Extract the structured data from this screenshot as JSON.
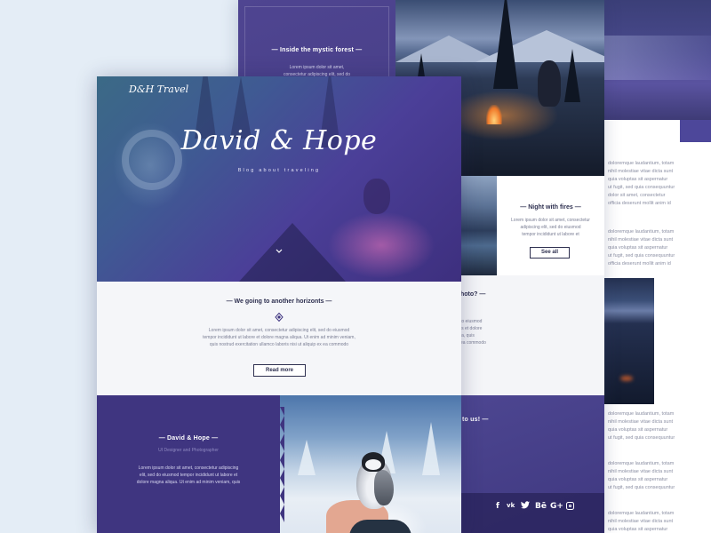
{
  "lorem": {
    "l1": "Lorem ipsum dolor sit amet,",
    "l2": "consectetur adipiscing elit, sed do",
    "l3": "Lorem ipsum dolor sit amet, consectetur",
    "l4": "adipiscing elit, sed do eiusmod",
    "l5": "tempor incididunt ut labore et",
    "l6": "Lorem ipsum dolor sit amet, consectetur adipiscing elit, sed do eiusmod",
    "l7": "tempor incididunt ut labore et dolore magna aliqua. Ut enim ad minim veniam,",
    "l8": "quis nostrud exercitation ullamco laboris nisi ut aliquip ex ea commodo",
    "l9": "Lorem ipsum dolor sit amet, consectetur adipiscing",
    "l10": "elit, sed do eiusmod tempor incididunt ut labore et",
    "l11": "dolore magna aliqua. Ut enim ad minim veniam, quis"
  },
  "back_page": {
    "forest_heading": "— Inside the mystic forest —",
    "fires_heading": "— Night with fires —",
    "fires_button": "See all",
    "photo_heading_partial": "hoto? —",
    "photo_text": [
      "to eiusmod",
      "is et dolore",
      "ia, quis",
      "ea commodo"
    ],
    "contact_heading_partial": "to us! —",
    "right_text": [
      "doloremque laudantium, totam",
      "nihil molestiae vitae dicta sunt",
      "quia voluptas sit aspernatur",
      "ut fugit, sed quia consequuntur",
      "dolor sit amet, consectetur",
      "officia deserunt mollit anim id"
    ]
  },
  "hero": {
    "logo": "D&H Travel",
    "title": "David & Hope",
    "subtitle": "Blog about traveling",
    "scroll_icon": "chevron-down-icon"
  },
  "about": {
    "heading": "— We going to another horizonts —",
    "icon": "diamond-icon",
    "button": "Read more"
  },
  "person": {
    "name": "— David & Hope —",
    "role": "UI Designer and Photographer"
  },
  "social": [
    "f",
    "vk",
    "twitter",
    "Bē",
    "G+",
    "instagram"
  ],
  "colors": {
    "accent_purple": "#3f3580",
    "dark_text": "#2e3050",
    "background": "#e4edf6"
  }
}
